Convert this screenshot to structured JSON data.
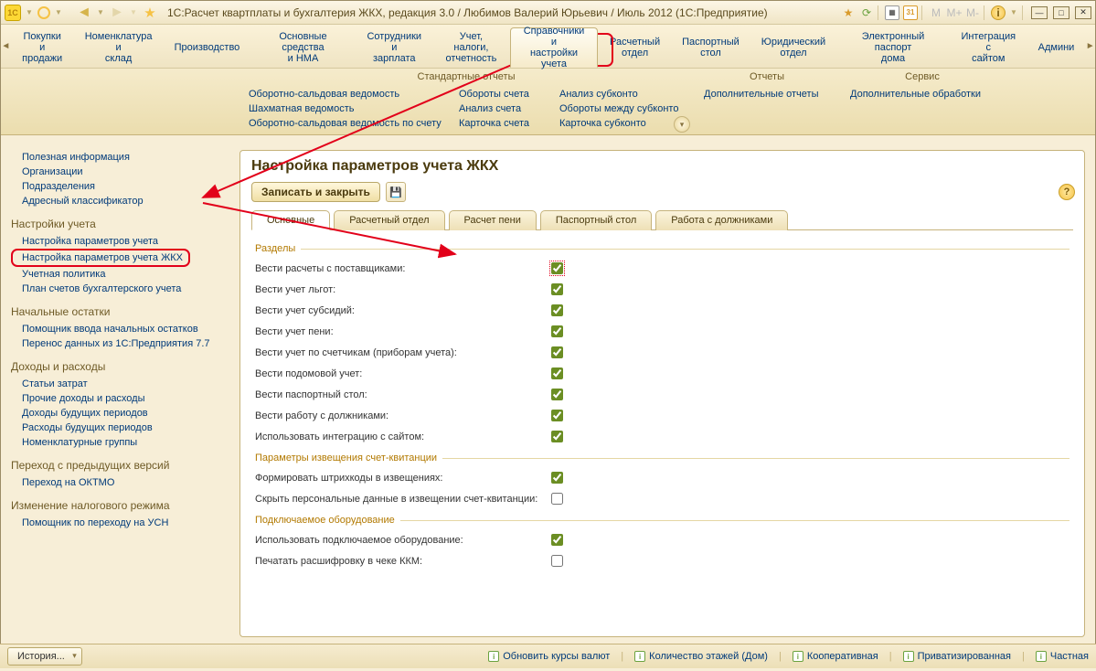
{
  "title": "1С:Расчет квартплаты и бухгалтерия ЖКХ, редакция 3.0 / Любимов Валерий Юрьевич / Июль 2012  (1С:Предприятие)",
  "mainmenu": [
    "Покупки и продажи",
    "Номенклатура и склад",
    "Производство",
    "Основные средства и НМА",
    "Сотрудники и зарплата",
    "Учет, налоги, отчетность",
    "Справочники и настройки учета",
    "Расчетный отдел",
    "Паспортный стол",
    "Юридический отдел",
    "Электронный паспорт дома",
    "Интеграция с сайтом",
    "Админи"
  ],
  "mainmenu_active": 6,
  "sub_headers": [
    "Стандартные отчеты",
    "Отчеты",
    "Сервис"
  ],
  "sub_cols": {
    "c1": [
      "Оборотно-сальдовая ведомость",
      "Шахматная ведомость",
      "Оборотно-сальдовая ведомость по счету"
    ],
    "c2": [
      "Обороты счета",
      "Анализ счета",
      "Карточка счета"
    ],
    "c3": [
      "Анализ субконто",
      "Обороты между субконто",
      "Карточка субконто"
    ],
    "c4": [
      "Дополнительные отчеты"
    ],
    "c5": [
      "Дополнительные обработки"
    ]
  },
  "sidebar": [
    {
      "title": "",
      "links": [
        "Полезная информация",
        "Организации",
        "Подразделения",
        "Адресный классификатор"
      ]
    },
    {
      "title": "Настройки учета",
      "links": [
        "Настройка параметров учета",
        "Настройка параметров учета ЖКХ",
        "Учетная политика",
        "План счетов бухгалтерского учета"
      ]
    },
    {
      "title": "Начальные остатки",
      "links": [
        "Помощник ввода начальных остатков",
        "Перенос данных из 1С:Предприятия 7.7"
      ]
    },
    {
      "title": "Доходы и расходы",
      "links": [
        "Статьи затрат",
        "Прочие доходы и расходы",
        "Доходы будущих периодов",
        "Расходы будущих периодов",
        "Номенклатурные группы"
      ]
    },
    {
      "title": "Переход с предыдущих версий",
      "links": [
        "Переход на ОКТМО"
      ]
    },
    {
      "title": "Изменение налогового режима",
      "links": [
        "Помощник по переходу на УСН"
      ]
    }
  ],
  "sidebar_boxed": "Настройка параметров учета ЖКХ",
  "content": {
    "title": "Настройка параметров учета ЖКХ",
    "save_btn": "Записать и закрыть",
    "tabs": [
      "Основные",
      "Расчетный отдел",
      "Расчет пени",
      "Паспортный стол",
      "Работа с должниками"
    ],
    "active_tab": 0,
    "sections": {
      "s1": {
        "title": "Разделы",
        "rows": [
          {
            "label": "Вести расчеты с поставщиками:",
            "checked": true,
            "highlight": true
          },
          {
            "label": "Вести учет льгот:",
            "checked": true
          },
          {
            "label": "Вести учет субсидий:",
            "checked": true
          },
          {
            "label": "Вести учет пени:",
            "checked": true
          },
          {
            "label": "Вести учет по счетчикам (приборам учета):",
            "checked": true
          },
          {
            "label": "Вести подомовой учет:",
            "checked": true
          },
          {
            "label": "Вести паспортный стол:",
            "checked": true
          },
          {
            "label": "Вести работу с должниками:",
            "checked": true
          },
          {
            "label": "Использовать интеграцию с сайтом:",
            "checked": true
          }
        ]
      },
      "s2": {
        "title": "Параметры извещения счет-квитанции",
        "rows": [
          {
            "label": "Формировать штрихкоды в извещениях:",
            "checked": true
          },
          {
            "label": "Скрыть персональные данные в извещении счет-квитанции:",
            "checked": false
          }
        ]
      },
      "s3": {
        "title": "Подключаемое оборудование",
        "rows": [
          {
            "label": "Использовать подключаемое оборудование:",
            "checked": true
          },
          {
            "label": "Печатать расшифровку в чеке ККМ:",
            "checked": false
          }
        ]
      }
    }
  },
  "statusbar": {
    "history": "История...",
    "links": [
      "Обновить курсы валют",
      "Количество этажей (Дом)",
      "Кооперативная",
      "Приватизированная",
      "Частная"
    ]
  }
}
